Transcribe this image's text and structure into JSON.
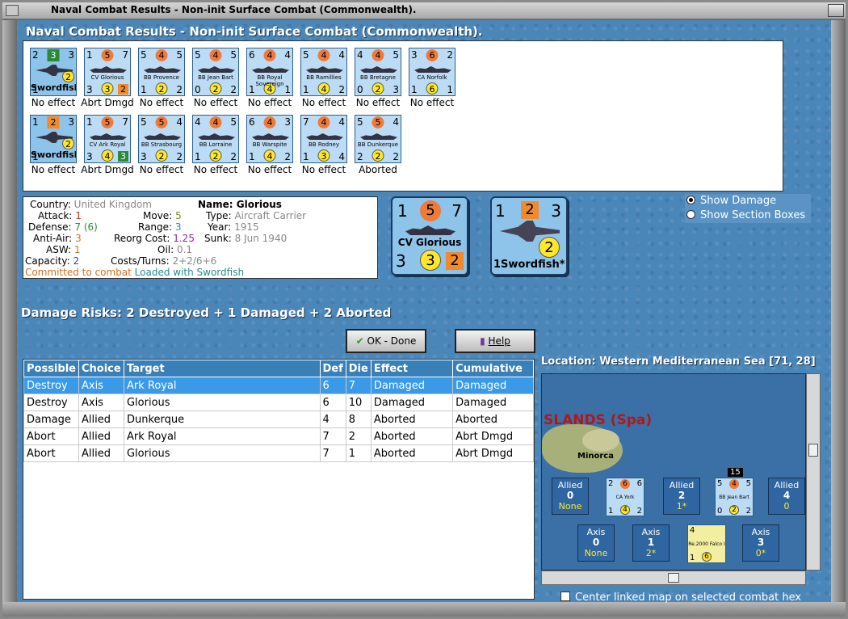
{
  "window": {
    "title": "Naval Combat Results - Non-init Surface Combat (Commonwealth)."
  },
  "header": {
    "title": "Naval Combat Results - Non-init Surface Combat (Commonwealth)."
  },
  "units": {
    "row1": [
      {
        "name": "Swordfish",
        "tl": "2",
        "tc": "3",
        "tr": "3",
        "bl": "1",
        "bc": "2",
        "br": "",
        "result": "No effect",
        "kind": "air"
      },
      {
        "name": "CV Glorious",
        "tl": "1",
        "tc": "5",
        "tr": "7",
        "bl": "3",
        "bc": "3",
        "br": "2",
        "result": "Abrt Dmgd",
        "kind": "ship"
      },
      {
        "name": "BB Provence",
        "tl": "5",
        "tc": "4",
        "tr": "5",
        "bl": "1",
        "bc": "2",
        "br": "2",
        "result": "No effect",
        "kind": "ship"
      },
      {
        "name": "BB Jean Bart",
        "tl": "5",
        "tc": "4",
        "tr": "5",
        "bl": "0",
        "bc": "2",
        "br": "2",
        "result": "No effect",
        "kind": "ship"
      },
      {
        "name": "BB Royal Sovereign",
        "tl": "6",
        "tc": "4",
        "tr": "4",
        "bl": "1",
        "bc": "4",
        "br": "1",
        "result": "No effect",
        "kind": "ship"
      },
      {
        "name": "BB Ramillies",
        "tl": "5",
        "tc": "4",
        "tr": "4",
        "bl": "1",
        "bc": "4",
        "br": "2",
        "result": "No effect",
        "kind": "ship"
      },
      {
        "name": "BB Bretagne",
        "tl": "4",
        "tc": "4",
        "tr": "5",
        "bl": "0",
        "bc": "2",
        "br": "3",
        "result": "No effect",
        "kind": "ship"
      },
      {
        "name": "CA Norfolk",
        "tl": "3",
        "tc": "6",
        "tr": "2",
        "bl": "1",
        "bc": "6",
        "br": "1",
        "result": "No effect",
        "kind": "ship"
      }
    ],
    "row2": [
      {
        "name": "Swordfish",
        "tl": "1",
        "tc": "2",
        "tr": "3",
        "bl": "1",
        "bc": "2",
        "br": "",
        "result": "No effect",
        "kind": "air"
      },
      {
        "name": "CV Ark Royal",
        "tl": "1",
        "tc": "5",
        "tr": "7",
        "bl": "3",
        "bc": "4",
        "br": "3",
        "result": "Abrt Dmgd",
        "kind": "ship"
      },
      {
        "name": "BB Strasbourg",
        "tl": "5",
        "tc": "5",
        "tr": "4",
        "bl": "3",
        "bc": "2",
        "br": "2",
        "result": "No effect",
        "kind": "ship"
      },
      {
        "name": "BB Lorraine",
        "tl": "4",
        "tc": "4",
        "tr": "5",
        "bl": "1",
        "bc": "2",
        "br": "2",
        "result": "No effect",
        "kind": "ship"
      },
      {
        "name": "BB Warspite",
        "tl": "6",
        "tc": "4",
        "tr": "3",
        "bl": "1",
        "bc": "4",
        "br": "2",
        "result": "No effect",
        "kind": "ship"
      },
      {
        "name": "BB Rodney",
        "tl": "7",
        "tc": "4",
        "tr": "4",
        "bl": "1",
        "bc": "3",
        "br": "4",
        "result": "No effect",
        "kind": "ship"
      },
      {
        "name": "BB Dunkerque",
        "tl": "5",
        "tc": "5",
        "tr": "4",
        "bl": "2",
        "bc": "2",
        "br": "2",
        "result": "Aborted",
        "kind": "ship"
      }
    ]
  },
  "info": {
    "country_label": "Country:",
    "country": "United Kingdom",
    "attack_label": "Attack:",
    "attack": "1",
    "defense_label": "Defense:",
    "defense": "7",
    "defense_extra": "(6)",
    "aa_label": "Anti-Air:",
    "aa": "3",
    "asw_label": "ASW:",
    "asw": "1",
    "capacity_label": "Capacity:",
    "capacity": "2",
    "move_label": "Move:",
    "move": "5",
    "range_label": "Range:",
    "range": "3",
    "reorg_label": "Reorg Cost:",
    "reorg": "1.25",
    "oil_label": "Oil:",
    "oil": "0.1",
    "costs_label": "Costs/Turns:",
    "costs": "2+2/6+6",
    "name_label": "Name:",
    "name": "Glorious",
    "type_label": "Type:",
    "type": "Aircraft Carrier",
    "year_label": "Year:",
    "year": "1915",
    "sunk_label": "Sunk:",
    "sunk": "8 Jun 1940",
    "committed": "Committed to combat",
    "loaded": "Loaded with Swordfish"
  },
  "bigship": {
    "tl": "1",
    "tc": "5",
    "tr": "7",
    "name": "CV Glorious",
    "bl": "3",
    "bc": "3",
    "br": "2"
  },
  "bigair": {
    "tl": "1",
    "tc": "2",
    "tr": "3",
    "bc": "2",
    "name": "1Swordfish*"
  },
  "options": {
    "show_damage": "Show Damage",
    "show_section": "Show Section Boxes"
  },
  "risks": "Damage Risks:  2 Destroyed + 1 Damaged + 2 Aborted",
  "buttons": {
    "ok": "OK - Done",
    "help": "Help"
  },
  "table": {
    "headers": [
      "Possible",
      "Choice",
      "Target",
      "Def",
      "Die",
      "Effect",
      "Cumulative"
    ],
    "rows": [
      [
        "Destroy",
        "Axis",
        "Ark Royal",
        "6",
        "7",
        "Damaged",
        "Damaged"
      ],
      [
        "Destroy",
        "Axis",
        "Glorious",
        "6",
        "10",
        "Damaged",
        "Damaged"
      ],
      [
        "Damage",
        "Allied",
        "Dunkerque",
        "4",
        "8",
        "Aborted",
        "Aborted"
      ],
      [
        "Abort",
        "Allied",
        "Ark Royal",
        "7",
        "2",
        "Aborted",
        "Abrt Dmgd"
      ],
      [
        "Abort",
        "Allied",
        "Glorious",
        "7",
        "1",
        "Aborted",
        "Abrt Dmgd"
      ]
    ]
  },
  "location": "Location:  Western Mediterranean Sea [71, 28]",
  "map": {
    "region": "SLANDS (Spa)",
    "island": "Minorca",
    "badge": "15",
    "boxes": [
      {
        "side": "Allied",
        "num": "0",
        "val": "None"
      },
      {
        "side": "Allied",
        "num": "2",
        "val": "1*"
      },
      {
        "side": "Allied",
        "num": "4",
        "val": "0"
      },
      {
        "side": "Axis",
        "num": "0",
        "val": "None"
      },
      {
        "side": "Axis",
        "num": "1",
        "val": "2*"
      },
      {
        "side": "Axis",
        "num": "3",
        "val": "0*"
      }
    ],
    "ca_york": {
      "name": "CA York",
      "tl": "2",
      "tc": "6",
      "tr": "6",
      "bl": "1",
      "bc": "4",
      "br": "2"
    },
    "jean_bart": {
      "name": "BB Jean Bart",
      "tl": "5",
      "tc": "4",
      "tr": "5",
      "bl": "0",
      "bc": "2",
      "br": "2"
    },
    "falco": {
      "name": "Re.2000 Falco I",
      "tl": "4",
      "bl": "1",
      "bc": "6"
    }
  },
  "center_linked": "Center linked map on selected combat hex"
}
